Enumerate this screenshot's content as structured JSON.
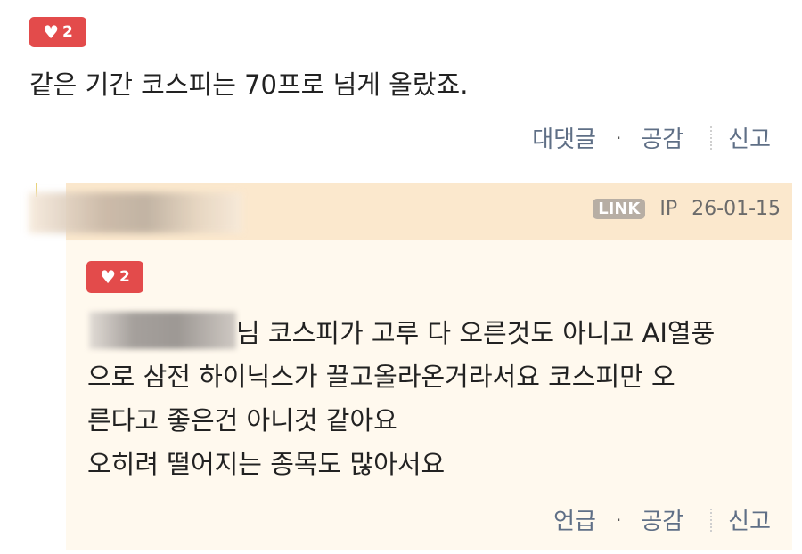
{
  "comment": {
    "likes": "2",
    "text": "같은 기간 코스피는 70프로 넘게 올랐죠.",
    "actions": {
      "reply": "대댓글",
      "empathy": "공감",
      "report": "신고"
    }
  },
  "reply": {
    "badge": "LINK",
    "ip_label": "IP",
    "date": "26-01-15",
    "likes": "2",
    "mention_tail": "님",
    "lines": [
      "코스피가 고루 다 오른것도 아니고 AI열풍",
      "으로 삼전 하이닉스가 끌고올라온거라서요 코스피만 오",
      "른다고 좋은건 아니것 같아요",
      "오히려 떨어지는 종목도 많아서요"
    ],
    "actions": {
      "mention": "언급",
      "empathy": "공감",
      "report": "신고"
    }
  },
  "colors": {
    "like_red": "#e34b4b",
    "action_blue": "#5f6f86",
    "reply_header_bg": "#fbe8cd",
    "reply_bg": "#fff9ee"
  }
}
